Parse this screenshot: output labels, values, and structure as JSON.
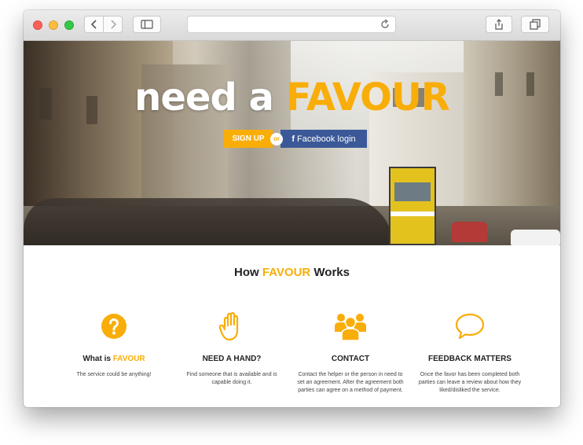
{
  "colors": {
    "accent": "#f9ad08",
    "facebook": "#3b5998"
  },
  "browser": {
    "icons": [
      "back-arrow-icon",
      "forward-arrow-icon",
      "sidebar-icon",
      "reload-icon",
      "share-icon",
      "tabs-icon"
    ],
    "address": ""
  },
  "hero": {
    "title_part1": "need a",
    "title_part2": "FAVOUR",
    "signup_label": "SIGN UP",
    "or_label": "or",
    "facebook_icon": "f",
    "facebook_label": "Facebook login"
  },
  "how": {
    "title_prefix": "How",
    "title_brand": "FAVOUR",
    "title_suffix": "Works",
    "features": [
      {
        "icon": "question-icon",
        "title_prefix": "What is",
        "title_brand": "FAVOUR",
        "title": "",
        "desc": "The service could be anything!"
      },
      {
        "icon": "hand-icon",
        "title_prefix": "",
        "title_brand": "",
        "title": "NEED A HAND?",
        "desc": "Find someone that is available and is capable doing it."
      },
      {
        "icon": "group-icon",
        "title_prefix": "",
        "title_brand": "",
        "title": "CONTACT",
        "desc": "Contact the helper or the person in need to set an agreement. After the agreement both parties can agree on a method of payment."
      },
      {
        "icon": "speech-bubble-icon",
        "title_prefix": "",
        "title_brand": "",
        "title": "FEEDBACK MATTERS",
        "desc": "Once the favor has been completed both parties can leave a review about how they liked/disliked the service."
      }
    ]
  }
}
